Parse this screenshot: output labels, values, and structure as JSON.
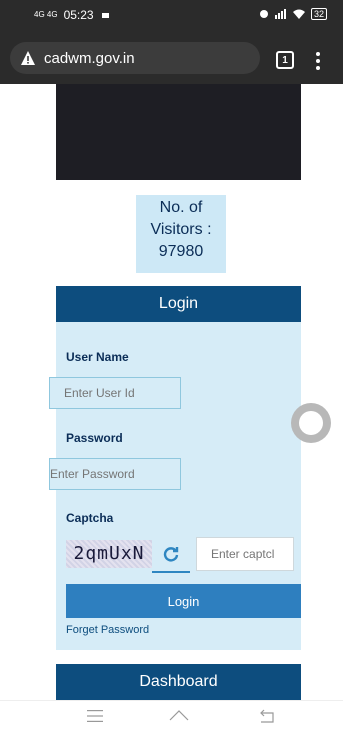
{
  "status_bar": {
    "signal": "4G 4G",
    "time": "05:23",
    "battery": "32"
  },
  "browser": {
    "url": "cadwm.gov.in",
    "tab_count": "1"
  },
  "visitors": {
    "label_line1": "No. of",
    "label_line2": "Visitors :",
    "count": "97980"
  },
  "login": {
    "title": "Login",
    "username_label": "User Name",
    "username_placeholder": "Enter User Id",
    "password_label": "Password",
    "password_placeholder": "Enter Password",
    "captcha_label": "Captcha",
    "captcha_code": "2qmUxN",
    "captcha_placeholder": "Enter captcl",
    "submit_label": "Login",
    "forgot_label": "Forget Password"
  },
  "dashboard": {
    "title": "Dashboard"
  },
  "colors": {
    "header_blue": "#0d4d7e",
    "panel_bg": "#d6ecf7",
    "button_blue": "#2e7fbf"
  }
}
